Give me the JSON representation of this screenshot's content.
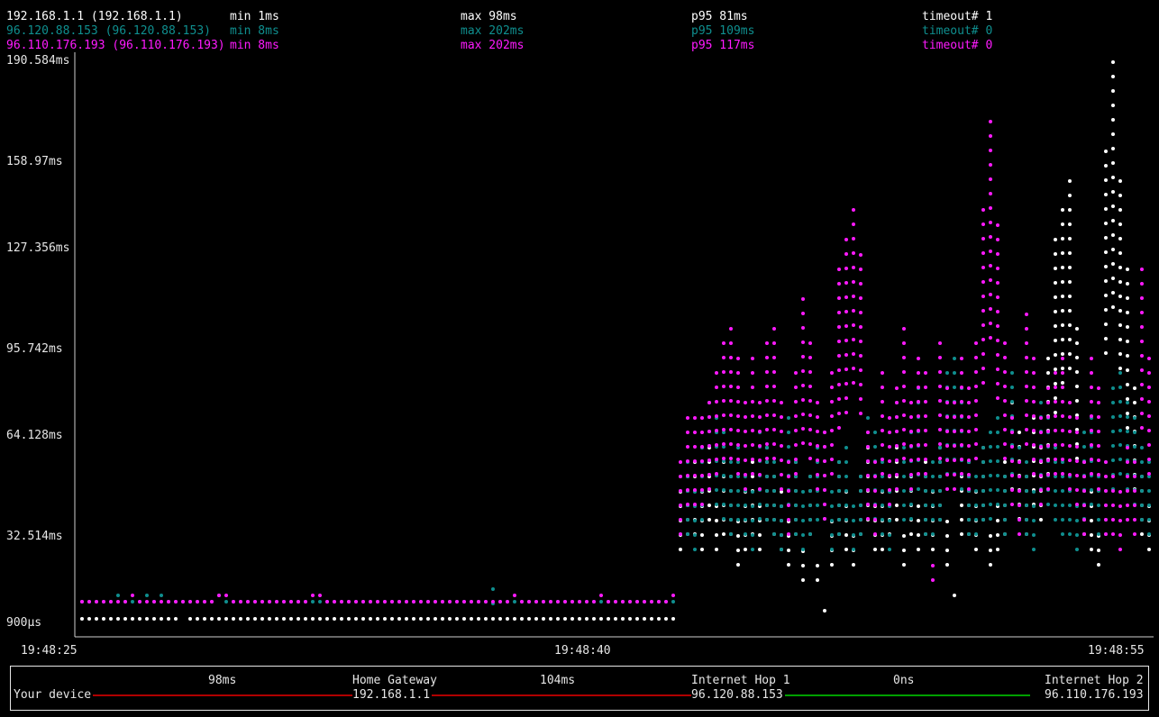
{
  "stats": [
    {
      "host": "192.168.1.1 (192.168.1.1)",
      "min": "min 1ms",
      "max": "max 98ms",
      "p95": "p95 81ms",
      "timeout": "timeout# 1",
      "color": "#ffffff"
    },
    {
      "host": "96.120.88.153 (96.120.88.153)",
      "min": "min 8ms",
      "max": "max 202ms",
      "p95": "p95 109ms",
      "timeout": "timeout# 0",
      "color": "#0f8f8f"
    },
    {
      "host": "96.110.176.193 (96.110.176.193)",
      "min": "min 8ms",
      "max": "max 202ms",
      "p95": "p95 117ms",
      "timeout": "timeout# 0",
      "color": "#ff1aff"
    }
  ],
  "chart_data": {
    "type": "scatter",
    "y_ticks": [
      "190.584ms",
      "158.97ms",
      "127.356ms",
      "95.742ms",
      "64.128ms",
      "32.514ms",
      "900µs"
    ],
    "ylim": [
      0.9,
      190.584
    ],
    "x_ticks": [
      "19:48:25",
      "19:48:40",
      "19:48:55"
    ],
    "series": [
      {
        "name": "192.168.1.1",
        "color": "#ffffff",
        "y": [
          2,
          2,
          2,
          2,
          2,
          2,
          2,
          2,
          2,
          2,
          2,
          2,
          2,
          2,
          null,
          2,
          2,
          2,
          2,
          2,
          2,
          2,
          2,
          2,
          2,
          2,
          2,
          2,
          2,
          2,
          2,
          2,
          2,
          2,
          2,
          2,
          2,
          2,
          2,
          2,
          2,
          2,
          2,
          2,
          2,
          2,
          2,
          2,
          2,
          2,
          2,
          2,
          2,
          2,
          2,
          2,
          2,
          2,
          2,
          2,
          2,
          2,
          2,
          2,
          2,
          2,
          2,
          2,
          2,
          2,
          2,
          2,
          2,
          2,
          2,
          2,
          2,
          2,
          2,
          2,
          2,
          2,
          2,
          45,
          50,
          55,
          45,
          60,
          40,
          55,
          50,
          35,
          45,
          55,
          40,
          60,
          50,
          45,
          35,
          55,
          25,
          50,
          20,
          5,
          35,
          55,
          45,
          30,
          50,
          60,
          40,
          45,
          50,
          60,
          30,
          50,
          40,
          55,
          45,
          60,
          35,
          10,
          50,
          55,
          45,
          60,
          30,
          40,
          55,
          75,
          65,
          50,
          70,
          60,
          90,
          130,
          140,
          150,
          100,
          55,
          45,
          30,
          160,
          190,
          150,
          120,
          80,
          50,
          40,
          55,
          45,
          35,
          60,
          70,
          65,
          70
        ]
      },
      {
        "name": "96.120.88.153",
        "color": "#0f8f8f",
        "y": [
          8,
          8,
          8,
          8,
          8,
          10,
          8,
          8,
          8,
          10,
          8,
          10,
          8,
          8,
          8,
          8,
          8,
          8,
          8,
          10,
          8,
          8,
          8,
          8,
          8,
          8,
          8,
          8,
          8,
          8,
          8,
          8,
          8,
          8,
          8,
          8,
          8,
          8,
          8,
          8,
          8,
          8,
          8,
          8,
          8,
          8,
          8,
          8,
          8,
          8,
          8,
          8,
          8,
          8,
          8,
          8,
          8,
          12,
          8,
          8,
          8,
          8,
          8,
          8,
          8,
          8,
          8,
          8,
          8,
          8,
          8,
          8,
          8,
          8,
          8,
          8,
          8,
          8,
          8,
          8,
          8,
          8,
          8,
          50,
          55,
          45,
          60,
          75,
          70,
          65,
          55,
          60,
          50,
          45,
          65,
          60,
          55,
          40,
          70,
          55,
          45,
          50,
          60,
          65,
          45,
          55,
          60,
          40,
          50,
          70,
          65,
          55,
          45,
          75,
          60,
          65,
          80,
          50,
          55,
          60,
          85,
          90,
          80,
          55,
          50,
          60,
          65,
          70,
          50,
          85,
          60,
          55,
          45,
          75,
          70,
          60,
          55,
          50,
          40,
          65,
          70,
          50,
          55,
          80,
          85,
          75,
          70,
          60,
          55,
          50,
          45,
          40,
          55,
          60,
          65,
          50
        ]
      },
      {
        "name": "96.110.176.193",
        "color": "#ff1aff",
        "y": [
          8,
          8,
          8,
          8,
          8,
          8,
          8,
          10,
          8,
          8,
          8,
          8,
          8,
          8,
          8,
          8,
          8,
          8,
          8,
          10,
          10,
          8,
          8,
          8,
          8,
          8,
          8,
          8,
          8,
          8,
          8,
          8,
          10,
          10,
          8,
          8,
          8,
          8,
          8,
          8,
          8,
          8,
          8,
          8,
          8,
          8,
          8,
          8,
          8,
          8,
          8,
          8,
          8,
          8,
          8,
          8,
          8,
          8,
          8,
          8,
          10,
          8,
          8,
          8,
          8,
          8,
          8,
          8,
          8,
          8,
          8,
          8,
          10,
          8,
          8,
          8,
          8,
          8,
          8,
          8,
          8,
          8,
          10,
          55,
          70,
          70,
          70,
          75,
          85,
          95,
          100,
          90,
          75,
          90,
          75,
          95,
          100,
          75,
          55,
          85,
          110,
          95,
          75,
          65,
          85,
          120,
          130,
          140,
          125,
          65,
          55,
          85,
          70,
          80,
          100,
          75,
          90,
          85,
          20,
          95,
          80,
          75,
          90,
          80,
          95,
          140,
          170,
          135,
          95,
          70,
          55,
          105,
          90,
          70,
          80,
          85,
          90,
          75,
          70,
          55,
          90,
          80,
          55,
          50,
          45,
          60,
          55,
          120,
          90,
          80
        ]
      }
    ]
  },
  "route": {
    "nodes": [
      {
        "name": "Your device",
        "ip": ""
      },
      {
        "name": "Home Gateway",
        "ip": "192.168.1.1"
      },
      {
        "name": "Internet Hop 1",
        "ip": "96.120.88.153"
      },
      {
        "name": "Internet Hop 2",
        "ip": "96.110.176.193"
      }
    ],
    "links": [
      {
        "latency": "98ms",
        "color": "#b00000"
      },
      {
        "latency": "104ms",
        "color": "#b00000"
      },
      {
        "latency": "0ns",
        "color": "#00a000"
      }
    ]
  }
}
